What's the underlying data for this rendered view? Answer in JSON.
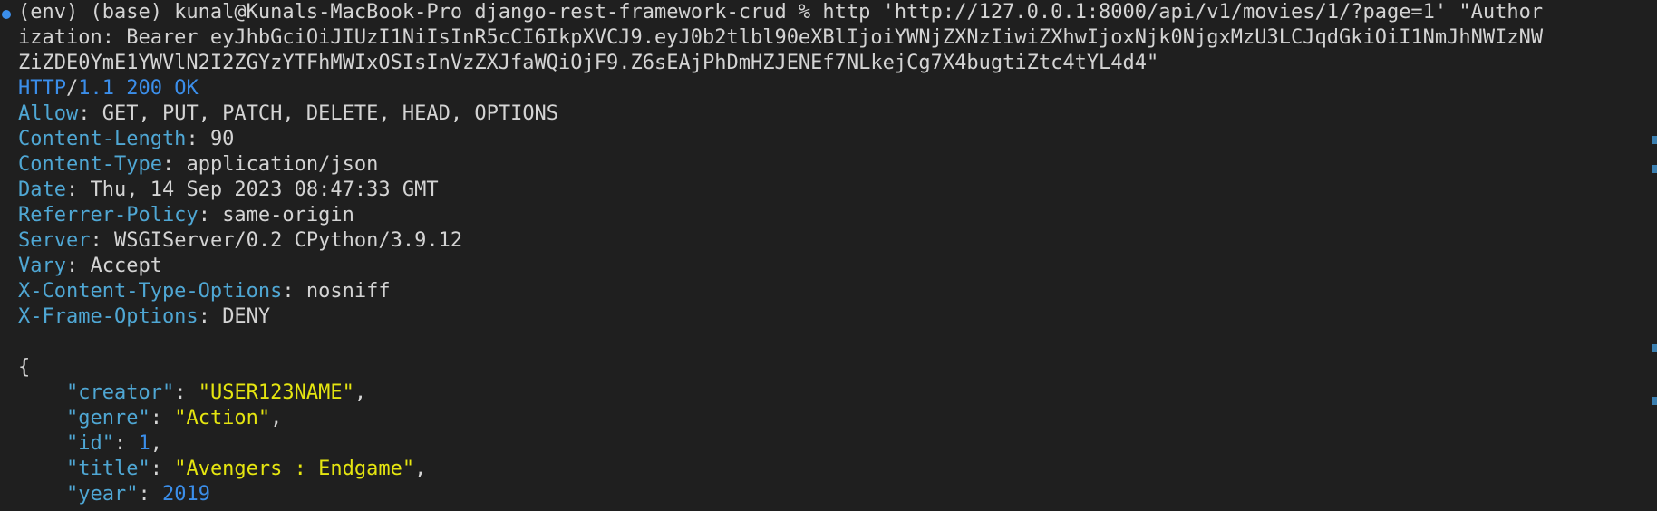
{
  "colors": {
    "background": "#1f1f1f",
    "text": "#d4d4d4",
    "header_key": "#4fa7d4",
    "status": "#3b8eea",
    "json_string": "#e5e510",
    "json_number": "#3b8eea"
  },
  "command": {
    "line1": "(env) (base) kunal@Kunals-MacBook-Pro django-rest-framework-crud % http 'http://127.0.0.1:8000/api/v1/movies/1/?page=1' \"Author",
    "line2": "ization: Bearer eyJhbGciOiJIUzI1NiIsInR5cCI6IkpXVCJ9.eyJ0b2tlbl90eXBlIjoiYWNjZXNzIiwiZXhwIjoxNjk0NjgxMzU3LCJqdGkiOiI1NmJhNWIzNW",
    "line3": "ZiZDE0YmE1YWVlN2I2ZGYzYTFhMWIxOSIsInVzZXJfaWQiOjF9.Z6sEAjPhDmHZJENEf7NLkejCg7X4bugtiZtc4tYL4d4\""
  },
  "status": {
    "protocol": "HTTP",
    "slash": "/",
    "rest": "1.1 200 OK"
  },
  "headers": [
    {
      "name": "Allow",
      "value": "GET, PUT, PATCH, DELETE, HEAD, OPTIONS"
    },
    {
      "name": "Content-Length",
      "value": "90"
    },
    {
      "name": "Content-Type",
      "value": "application/json"
    },
    {
      "name": "Date",
      "value": "Thu, 14 Sep 2023 08:47:33 GMT"
    },
    {
      "name": "Referrer-Policy",
      "value": "same-origin"
    },
    {
      "name": "Server",
      "value": "WSGIServer/0.2 CPython/3.9.12"
    },
    {
      "name": "Vary",
      "value": "Accept"
    },
    {
      "name": "X-Content-Type-Options",
      "value": "nosniff"
    },
    {
      "name": "X-Frame-Options",
      "value": "DENY"
    }
  ],
  "body": {
    "open_brace": "{",
    "fields": [
      {
        "key": "\"creator\"",
        "value": "\"USER123NAME\"",
        "type": "string",
        "trail": ","
      },
      {
        "key": "\"genre\"",
        "value": "\"Action\"",
        "type": "string",
        "trail": ","
      },
      {
        "key": "\"id\"",
        "value": "1",
        "type": "number",
        "trail": ","
      },
      {
        "key": "\"title\"",
        "value": "\"Avengers : Endgame\"",
        "type": "string",
        "trail": ","
      },
      {
        "key": "\"year\"",
        "value": "2019",
        "type": "number",
        "trail": ""
      }
    ]
  }
}
